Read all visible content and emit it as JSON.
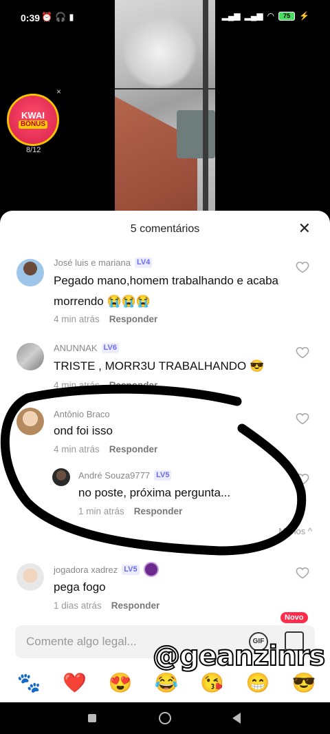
{
  "status": {
    "time": "0:39",
    "battery": "75"
  },
  "kwai": {
    "line1": "KWAI",
    "line2": "BÔNUS",
    "progress": "8/12",
    "close": "×"
  },
  "sheet": {
    "title": "5 comentários",
    "close": "✕"
  },
  "comments": [
    {
      "name": "José luis e mariana",
      "level": "LV4",
      "text": "Pegado mano,homem trabalhando e acaba morrendo 😭😭😭",
      "time": "4 min atrás",
      "reply": "Responder"
    },
    {
      "name": "ANUNNAK",
      "level": "LV6",
      "text": "TRISTE , MORR3U TRABALHANDO 😎",
      "time": "4 min atrás",
      "reply": "Responder"
    },
    {
      "name": "Antônio Braco",
      "level": "",
      "text": "ond foi isso",
      "time": "4 min atrás",
      "reply": "Responder"
    },
    {
      "name": "André Souza9777",
      "level": "LV5",
      "text": "no poste, próxima pergunta...",
      "time": "1 min atrás",
      "reply": "Responder"
    },
    {
      "name": "jogadora xadrez",
      "level": "LV5",
      "text": "pega fogo",
      "time": "1 dias atrás",
      "reply": "Responder"
    }
  ],
  "more_replies": "Menos ^",
  "input": {
    "placeholder": "Comente algo legal...",
    "gif": "GIF",
    "new_badge": "Novo"
  },
  "emojis": [
    "🐾",
    "❤️",
    "😍",
    "😂",
    "😘",
    "😁",
    "😎"
  ],
  "watermark": "@geanzinrs",
  "colors": {
    "accent": "#6a6af0",
    "like": "#ff2d4b",
    "sheet": "#ffffff"
  }
}
